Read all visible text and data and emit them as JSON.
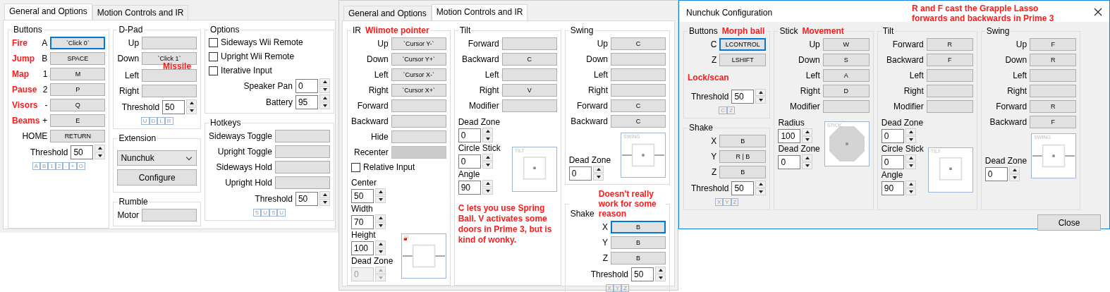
{
  "panels": [
    {
      "kind": "tabbed",
      "tabs": [
        {
          "label": "General and Options",
          "selected": true
        },
        {
          "label": "Motion Controls and IR",
          "selected": false
        }
      ],
      "columns": [
        [
          {
            "title": "Buttons",
            "rows": [
              {
                "kind": "binding",
                "note": "Fire",
                "label": "A",
                "value": "`Click 0`",
                "focused": true
              },
              {
                "kind": "binding",
                "note": "Jump",
                "label": "B",
                "value": "SPACE",
                "focused": false
              },
              {
                "kind": "binding",
                "note": "Map",
                "label": "1",
                "value": "M",
                "focused": false
              },
              {
                "kind": "binding",
                "note": "Pause",
                "label": "2",
                "value": "P",
                "focused": false
              },
              {
                "kind": "binding",
                "note": "Visors",
                "label": "-",
                "value": "Q",
                "focused": false
              },
              {
                "kind": "binding",
                "note": "Beams",
                "label": "+",
                "value": "E",
                "focused": false
              },
              {
                "kind": "binding",
                "label": "HOME",
                "value": "RETURN",
                "focused": false
              },
              {
                "kind": "spin",
                "label": "Threshold",
                "value": "50"
              },
              {
                "kind": "indicators",
                "keys": [
                  "A",
                  "B",
                  "1",
                  "2",
                  "-",
                  "+",
                  "O"
                ]
              }
            ]
          }
        ],
        [
          {
            "title": "D-Pad",
            "rows": [
              {
                "kind": "binding",
                "label": "Up",
                "focused": false
              },
              {
                "kind": "binding",
                "label": "Down",
                "value": "`Click 1`",
                "focused": false
              },
              {
                "kind": "note",
                "text": "Missile"
              },
              {
                "kind": "binding",
                "label": "Left",
                "focused": false
              },
              {
                "kind": "binding",
                "label": "Right",
                "focused": false
              },
              {
                "kind": "spin",
                "label": "Threshold",
                "value": "50"
              },
              {
                "kind": "indicators",
                "keys": [
                  "U",
                  "D",
                  "L",
                  "R"
                ]
              }
            ]
          },
          {
            "title": "Extension",
            "rows": [
              {
                "kind": "dropdown",
                "value": "Nunchuk"
              },
              {
                "kind": "button",
                "label": "Configure"
              }
            ]
          },
          {
            "title": "Rumble",
            "rows": [
              {
                "kind": "binding",
                "label": "Motor",
                "focused": false
              }
            ]
          }
        ],
        [
          {
            "title": "Options",
            "rows": [
              {
                "kind": "checkbox",
                "label": "Sideways Wii Remote",
                "checked": false
              },
              {
                "kind": "checkbox",
                "label": "Upright Wii Remote",
                "checked": false
              },
              {
                "kind": "checkbox",
                "label": "Iterative Input",
                "checked": false
              },
              {
                "kind": "spin",
                "label": "Speaker Pan",
                "value": "0"
              },
              {
                "kind": "spin",
                "label": "Battery",
                "value": "95"
              }
            ]
          },
          {
            "title": "Hotkeys",
            "rows": [
              {
                "kind": "binding",
                "label": "Sideways Toggle",
                "focused": false
              },
              {
                "kind": "binding",
                "label": "Upright Toggle",
                "focused": false
              },
              {
                "kind": "binding",
                "label": "Sideways Hold",
                "focused": false
              },
              {
                "kind": "binding",
                "label": "Upright Hold",
                "focused": false
              },
              {
                "kind": "spin",
                "label": "Threshold",
                "value": "50"
              },
              {
                "kind": "indicators",
                "keys": [
                  "S",
                  "U",
                  "S",
                  "U"
                ]
              }
            ]
          }
        ]
      ]
    },
    {
      "kind": "tabbed",
      "tabs": [
        {
          "label": "General and Options",
          "selected": false
        },
        {
          "label": "Motion Controls and IR",
          "selected": true
        }
      ],
      "columns": [
        [
          {
            "title": "IR",
            "note": "Wiimote pointer",
            "rows": [
              {
                "kind": "binding",
                "label": "Up",
                "value": "`Cursor Y-`",
                "focused": false
              },
              {
                "kind": "binding",
                "label": "Down",
                "value": "`Cursor Y+`",
                "focused": false
              },
              {
                "kind": "binding",
                "label": "Left",
                "value": "`Cursor X-`",
                "focused": false
              },
              {
                "kind": "binding",
                "label": "Right",
                "value": "`Cursor X+`",
                "focused": false
              },
              {
                "kind": "binding",
                "label": "Forward",
                "focused": false
              },
              {
                "kind": "binding",
                "label": "Backward",
                "focused": false
              },
              {
                "kind": "binding",
                "label": "Hide",
                "focused": false
              },
              {
                "kind": "binding",
                "label": "Recenter",
                "focused": false,
                "disabled": true
              },
              {
                "kind": "checkbox",
                "label": "Relative Input",
                "checked": false
              },
              {
                "kind": "preview-block",
                "fields": [
                  {
                    "label": "Center",
                    "value": "50"
                  },
                  {
                    "label": "Width",
                    "value": "70"
                  },
                  {
                    "label": "Height",
                    "value": "100"
                  },
                  {
                    "label": "Dead Zone",
                    "value": "0",
                    "disabled": true
                  }
                ],
                "preview": {
                  "kind": "ir",
                  "caption": "IR"
                }
              }
            ]
          }
        ],
        [
          {
            "title": "Tilt",
            "rows": [
              {
                "kind": "binding",
                "label": "Forward",
                "focused": false
              },
              {
                "kind": "binding",
                "label": "Backward",
                "value": "C",
                "focused": false
              },
              {
                "kind": "binding",
                "label": "Left",
                "focused": false
              },
              {
                "kind": "binding",
                "label": "Right",
                "value": "V",
                "focused": false
              },
              {
                "kind": "binding",
                "label": "Modifier",
                "focused": false
              },
              {
                "kind": "preview-block",
                "fields": [
                  {
                    "label": "Dead Zone",
                    "value": "0"
                  },
                  {
                    "label": "Circle Stick",
                    "value": "0"
                  },
                  {
                    "label": "Angle",
                    "value": "90"
                  }
                ],
                "preview": {
                  "kind": "box",
                  "caption": "TILT"
                }
              },
              {
                "kind": "note",
                "text": "C lets you use Spring Ball. V activates some doors in Prime 3, but is kind of wonky."
              }
            ]
          }
        ],
        [
          {
            "title": "Swing",
            "rows": [
              {
                "kind": "binding",
                "label": "Up",
                "value": "C",
                "focused": false
              },
              {
                "kind": "binding",
                "label": "Down",
                "focused": false
              },
              {
                "kind": "binding",
                "label": "Left",
                "focused": false
              },
              {
                "kind": "binding",
                "label": "Right",
                "focused": false
              },
              {
                "kind": "binding",
                "label": "Forward",
                "value": "C",
                "focused": false
              },
              {
                "kind": "binding",
                "label": "Backward",
                "value": "C",
                "focused": false
              },
              {
                "kind": "preview-block",
                "fields": [
                  {
                    "label": "Dead Zone",
                    "value": "0"
                  }
                ],
                "preview": {
                  "kind": "bar",
                  "caption": "SWING"
                }
              }
            ]
          },
          {
            "title": "Shake",
            "note": "Doesn't really work for some reason",
            "rows": [
              {
                "kind": "binding",
                "label": "X",
                "value": "B",
                "focused": true
              },
              {
                "kind": "binding",
                "label": "Y",
                "value": "B",
                "focused": false
              },
              {
                "kind": "binding",
                "label": "Z",
                "value": "B",
                "focused": false
              },
              {
                "kind": "spin",
                "label": "Threshold",
                "value": "50"
              },
              {
                "kind": "indicators",
                "keys": [
                  "X",
                  "Y",
                  "Z"
                ]
              }
            ]
          }
        ]
      ]
    },
    {
      "kind": "dialog",
      "title": "Nunchuk Configuration",
      "note": "R and F cast the Grapple Lasso forwards and backwards in Prime 3",
      "button": "Close",
      "columns": [
        [
          {
            "title": "Buttons",
            "note": "Morph ball",
            "rows": [
              {
                "kind": "binding",
                "label": "C",
                "value": "LCONTROL",
                "focused": true
              },
              {
                "kind": "binding",
                "label": "Z",
                "value": "LSHIFT",
                "focused": false
              },
              {
                "kind": "note",
                "text": "Lock/scan"
              },
              {
                "kind": "spin",
                "label": "Threshold",
                "value": "50"
              },
              {
                "kind": "indicators",
                "keys": [
                  "C",
                  "Z"
                ]
              }
            ]
          },
          {
            "title": "Shake",
            "rows": [
              {
                "kind": "binding",
                "label": "X",
                "value": "B",
                "focused": false
              },
              {
                "kind": "binding",
                "label": "Y",
                "value": "R | B",
                "focused": false
              },
              {
                "kind": "binding",
                "label": "Z",
                "value": "B",
                "focused": false
              },
              {
                "kind": "spin",
                "label": "Threshold",
                "value": "50"
              },
              {
                "kind": "indicators",
                "keys": [
                  "X",
                  "Y",
                  "Z"
                ]
              }
            ]
          }
        ],
        [
          {
            "title": "Stick",
            "note": "Movement",
            "rows": [
              {
                "kind": "binding",
                "label": "Up",
                "value": "W",
                "focused": false
              },
              {
                "kind": "binding",
                "label": "Down",
                "value": "S",
                "focused": false
              },
              {
                "kind": "binding",
                "label": "Left",
                "value": "A",
                "focused": false
              },
              {
                "kind": "binding",
                "label": "Right",
                "value": "D",
                "focused": false
              },
              {
                "kind": "binding",
                "label": "Modifier",
                "focused": false
              },
              {
                "kind": "preview-block",
                "fields": [
                  {
                    "label": "Radius",
                    "value": "100"
                  },
                  {
                    "label": "Dead Zone",
                    "value": "0"
                  }
                ],
                "preview": {
                  "kind": "octagon",
                  "caption": "STICK"
                }
              }
            ]
          }
        ],
        [
          {
            "title": "Tilt",
            "rows": [
              {
                "kind": "binding",
                "label": "Forward",
                "value": "R",
                "focused": false
              },
              {
                "kind": "binding",
                "label": "Backward",
                "value": "F",
                "focused": false
              },
              {
                "kind": "binding",
                "label": "Left",
                "focused": false
              },
              {
                "kind": "binding",
                "label": "Right",
                "focused": false
              },
              {
                "kind": "binding",
                "label": "Modifier",
                "focused": false
              },
              {
                "kind": "preview-block",
                "fields": [
                  {
                    "label": "Dead Zone",
                    "value": "0"
                  },
                  {
                    "label": "Circle Stick",
                    "value": "0"
                  },
                  {
                    "label": "Angle",
                    "value": "90"
                  }
                ],
                "preview": {
                  "kind": "box",
                  "caption": "TILT"
                }
              }
            ]
          }
        ],
        [
          {
            "title": "Swing",
            "rows": [
              {
                "kind": "binding",
                "label": "Up",
                "value": "F",
                "focused": false
              },
              {
                "kind": "binding",
                "label": "Down",
                "value": "R",
                "focused": false
              },
              {
                "kind": "binding",
                "label": "Left",
                "focused": false
              },
              {
                "kind": "binding",
                "label": "Right",
                "focused": false
              },
              {
                "kind": "binding",
                "label": "Forward",
                "value": "R",
                "focused": false
              },
              {
                "kind": "binding",
                "label": "Backward",
                "value": "F",
                "focused": false
              },
              {
                "kind": "preview-block",
                "fields": [
                  {
                    "label": "Dead Zone",
                    "value": "0"
                  }
                ],
                "preview": {
                  "kind": "bar",
                  "caption": "SWING"
                }
              }
            ]
          }
        ]
      ]
    }
  ]
}
